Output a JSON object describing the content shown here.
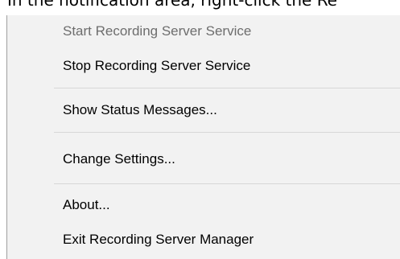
{
  "instruction": {
    "text": "In the notification area, right-click the Re"
  },
  "menu": {
    "items": [
      {
        "label": "Start Recording Server Service",
        "enabled": false
      },
      {
        "label": "Stop Recording Server Service",
        "enabled": true
      },
      {
        "label": "Show Status Messages...",
        "enabled": true
      },
      {
        "label": "Change Settings...",
        "enabled": true
      },
      {
        "label": "About...",
        "enabled": true
      },
      {
        "label": "Exit Recording Server Manager",
        "enabled": true
      }
    ]
  },
  "colors": {
    "menu_background": "#f2f2f2",
    "disabled_text": "#6d6d6d",
    "separator": "#d7d7d7"
  }
}
